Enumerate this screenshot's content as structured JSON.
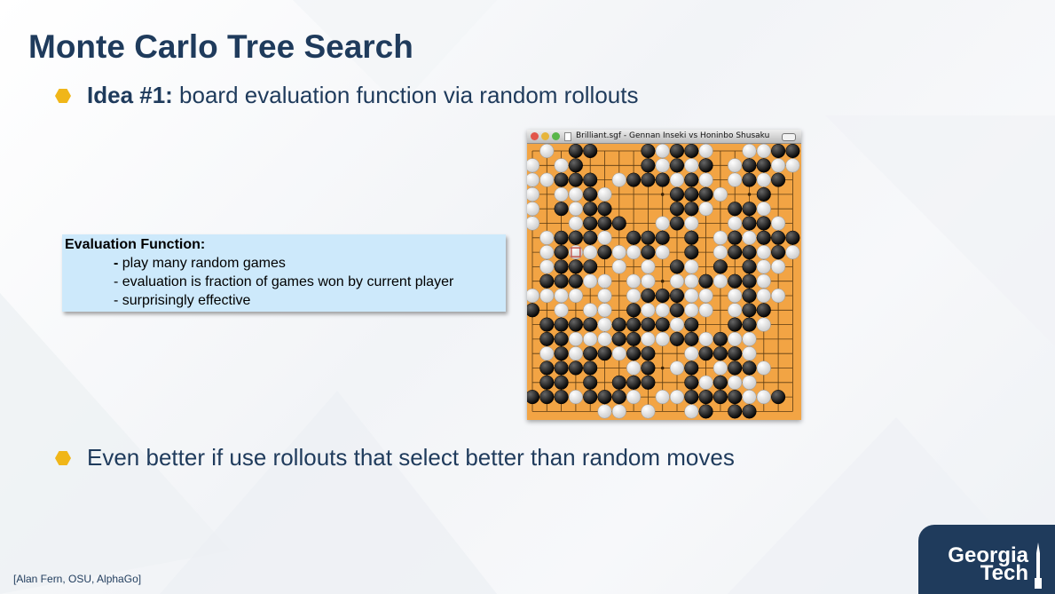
{
  "slide": {
    "title": "Monte Carlo Tree Search",
    "bullets": [
      {
        "strong": "Idea #1:",
        "text": " board evaluation function via random rollouts"
      },
      {
        "strong": "",
        "text": "Even better if use rollouts that select better than random moves"
      }
    ],
    "eval_box": {
      "title": "Evaluation Function:",
      "items": [
        {
          "dash": "-",
          "text": " play many random games"
        },
        {
          "dash": "-",
          "text": " evaluation is fraction of games won by current player"
        },
        {
          "dash": "-",
          "text": " surprisingly effective"
        }
      ]
    },
    "citation": "[Alan Fern, OSU, AlphaGo]",
    "logo": {
      "line1": "Georgia",
      "line2": "Tech"
    }
  },
  "go_window": {
    "title": "Brilliant.sgf - Gennan Inseki vs Honinbo Shusaku",
    "board_size": 19,
    "last_move": [
      3,
      7
    ],
    "stones": [
      ".w.bb...bwbbw..wwbb",
      "w.wb....bwbwb.wbbww",
      "wwbbb.wbbbwbw.wbwb.",
      "w.wwbw....bbbw..b..",
      "w.bwbb....bbw.bbw..",
      "w..wbbb..wbw..wbbw.",
      ".wbbbw.bbb.b.wbwbbb",
      ".wbwwbwwbw.b.wbbwbw",
      ".wbbb.w.w.bw.b.bww.",
      ".bbbww.ww.wwbwbbw..",
      "wwww.w.wbbbww.wbww.",
      "b.w.ww.bwwbww.wbb..",
      ".bbbbwbbbbwb..bbw..",
      ".bbwwwbbwwbbwbww...",
      ".wbwbbwbb..wbbbw...",
      ".bbbb..wb.wb.wbbw..",
      ".bb.b.bbb..bwbww...",
      "bbbwbbbw.wwbbbbwwb.",
      ".....ww.w..wb.bb...",
      ".....ww.w..b.b....b"
    ]
  },
  "colors": {
    "title": "#1f3b5c",
    "bullet_hex": "#f0b619",
    "eval_box": "#cde9fb",
    "board": "#f2a444",
    "logo_bg": "#1f3b5c"
  }
}
